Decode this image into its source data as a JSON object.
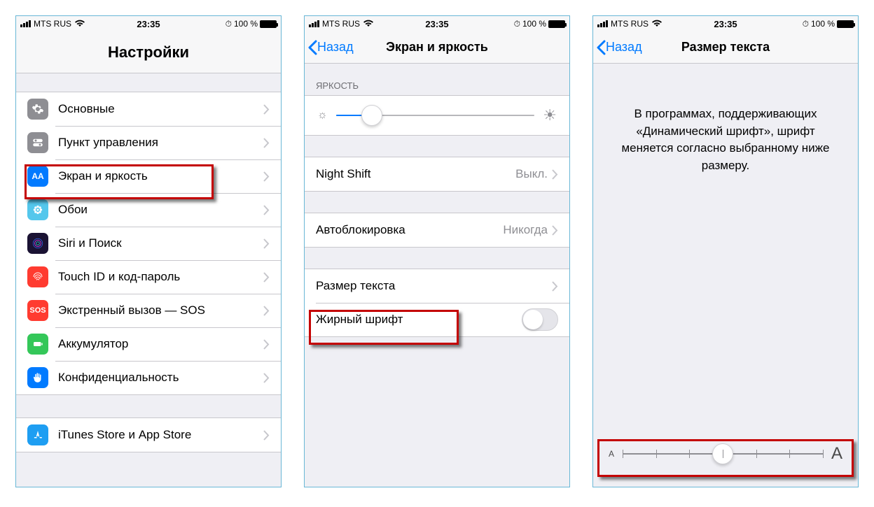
{
  "status": {
    "carrier": "MTS RUS",
    "time": "23:35",
    "battery": "100 %"
  },
  "phone1": {
    "title": "Настройки",
    "items": [
      {
        "label": "Основные"
      },
      {
        "label": "Пункт управления"
      },
      {
        "label": "Экран и яркость"
      },
      {
        "label": "Обои"
      },
      {
        "label": "Siri и Поиск"
      },
      {
        "label": "Touch ID и код-пароль"
      },
      {
        "label": "Экстренный вызов — SOS"
      },
      {
        "label": "Аккумулятор"
      },
      {
        "label": "Конфиденциальность"
      }
    ],
    "store": {
      "label": "iTunes Store и App Store"
    }
  },
  "phone2": {
    "back": "Назад",
    "title": "Экран и яркость",
    "brightness_header": "ЯРКОСТЬ",
    "brightness_percent": 18,
    "nightshift": {
      "label": "Night Shift",
      "value": "Выкл."
    },
    "autolock": {
      "label": "Автоблокировка",
      "value": "Никогда"
    },
    "textsize": {
      "label": "Размер текста"
    },
    "bold": {
      "label": "Жирный шрифт",
      "on": false
    }
  },
  "phone3": {
    "back": "Назад",
    "title": "Размер текста",
    "body": "В программах, поддерживающих «Динамический шрифт», шрифт меняется согласно выбранному ниже размеру.",
    "slider": {
      "steps": 7,
      "index": 3
    }
  }
}
